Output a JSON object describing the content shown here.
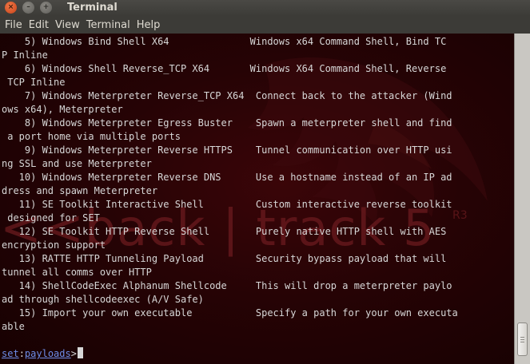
{
  "window": {
    "title": "Terminal",
    "buttons": {
      "close": "×",
      "minimize": "–",
      "maximize": "+"
    }
  },
  "menu": [
    "File",
    "Edit",
    "View",
    "Terminal",
    "Help"
  ],
  "wallpaper": {
    "logo_text": "<<back | track 5",
    "superscript": "R3"
  },
  "terminal_lines": [
    "    5) Windows Bind Shell X64              Windows x64 Command Shell, Bind TC",
    "P Inline",
    "    6) Windows Shell Reverse_TCP X64       Windows X64 Command Shell, Reverse",
    " TCP Inline",
    "    7) Windows Meterpreter Reverse_TCP X64  Connect back to the attacker (Wind",
    "ows x64), Meterpreter",
    "    8) Windows Meterpreter Egress Buster    Spawn a meterpreter shell and find",
    " a port home via multiple ports",
    "    9) Windows Meterpreter Reverse HTTPS    Tunnel communication over HTTP usi",
    "ng SSL and use Meterpreter",
    "   10) Windows Meterpreter Reverse DNS      Use a hostname instead of an IP ad",
    "dress and spawn Meterpreter",
    "   11) SE Toolkit Interactive Shell         Custom interactive reverse toolkit",
    " designed for SET",
    "   12) SE Toolkit HTTP Reverse Shell        Purely native HTTP shell with AES",
    "encryption support",
    "   13) RATTE HTTP Tunneling Payload         Security bypass payload that will",
    "tunnel all comms over HTTP",
    "   14) ShellCodeExec Alphanum Shellcode     This will drop a meterpreter paylo",
    "ad through shellcodeexec (A/V Safe)",
    "   15) Import your own executable           Specify a path for your own executa",
    "able",
    ""
  ],
  "prompt": {
    "set": "set",
    "separator": ":",
    "context": "payloads",
    "suffix": ">"
  }
}
